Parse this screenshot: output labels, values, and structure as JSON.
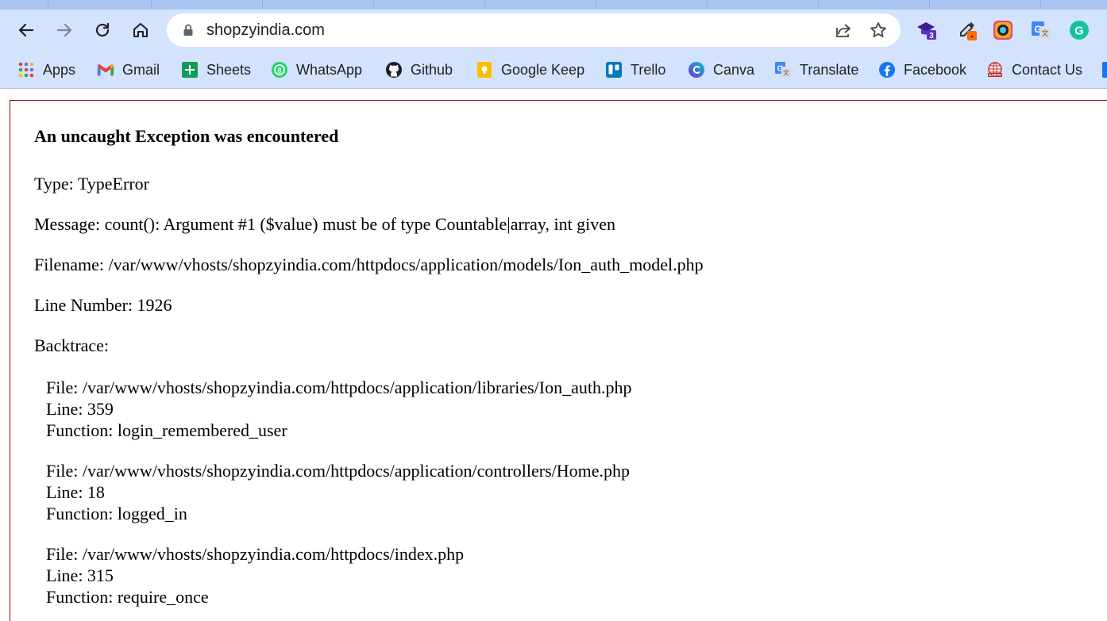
{
  "browser": {
    "url": "shopzyindia.com",
    "extensions": [
      {
        "name": "graduation-cap-extension-icon",
        "badge": "3"
      },
      {
        "name": "eyedropper-extension-icon"
      },
      {
        "name": "screen-recorder-extension-icon"
      },
      {
        "name": "google-translate-extension-icon"
      },
      {
        "name": "grammarly-extension-icon"
      }
    ]
  },
  "bookmarks": [
    {
      "label": "Apps",
      "icon": "apps-grid-icon"
    },
    {
      "label": "Gmail",
      "icon": "gmail-icon"
    },
    {
      "label": "Sheets",
      "icon": "sheets-icon"
    },
    {
      "label": "WhatsApp",
      "icon": "whatsapp-icon"
    },
    {
      "label": "Github",
      "icon": "github-icon"
    },
    {
      "label": "Google Keep",
      "icon": "google-keep-icon"
    },
    {
      "label": "Trello",
      "icon": "trello-icon"
    },
    {
      "label": "Canva",
      "icon": "canva-icon"
    },
    {
      "label": "Translate",
      "icon": "translate-icon"
    },
    {
      "label": "Facebook",
      "icon": "facebook-icon"
    },
    {
      "label": "Contact Us",
      "icon": "earth-icon"
    }
  ],
  "error": {
    "heading": "An uncaught Exception was encountered",
    "type": "Type: TypeError",
    "message": "Message: count(): Argument #1 ($value) must be of type Countable|array, int given",
    "filename": "Filename: /var/www/vhosts/shopzyindia.com/httpdocs/application/models/Ion_auth_model.php",
    "line_number": "Line Number: 1926",
    "backtrace_label": "Backtrace:",
    "backtrace": [
      {
        "file": "File: /var/www/vhosts/shopzyindia.com/httpdocs/application/libraries/Ion_auth.php",
        "line": "Line: 359",
        "function": "Function: login_remembered_user"
      },
      {
        "file": "File: /var/www/vhosts/shopzyindia.com/httpdocs/application/controllers/Home.php",
        "line": "Line: 18",
        "function": "Function: logged_in"
      },
      {
        "file": "File: /var/www/vhosts/shopzyindia.com/httpdocs/index.php",
        "line": "Line: 315",
        "function": "Function: require_once"
      }
    ]
  }
}
